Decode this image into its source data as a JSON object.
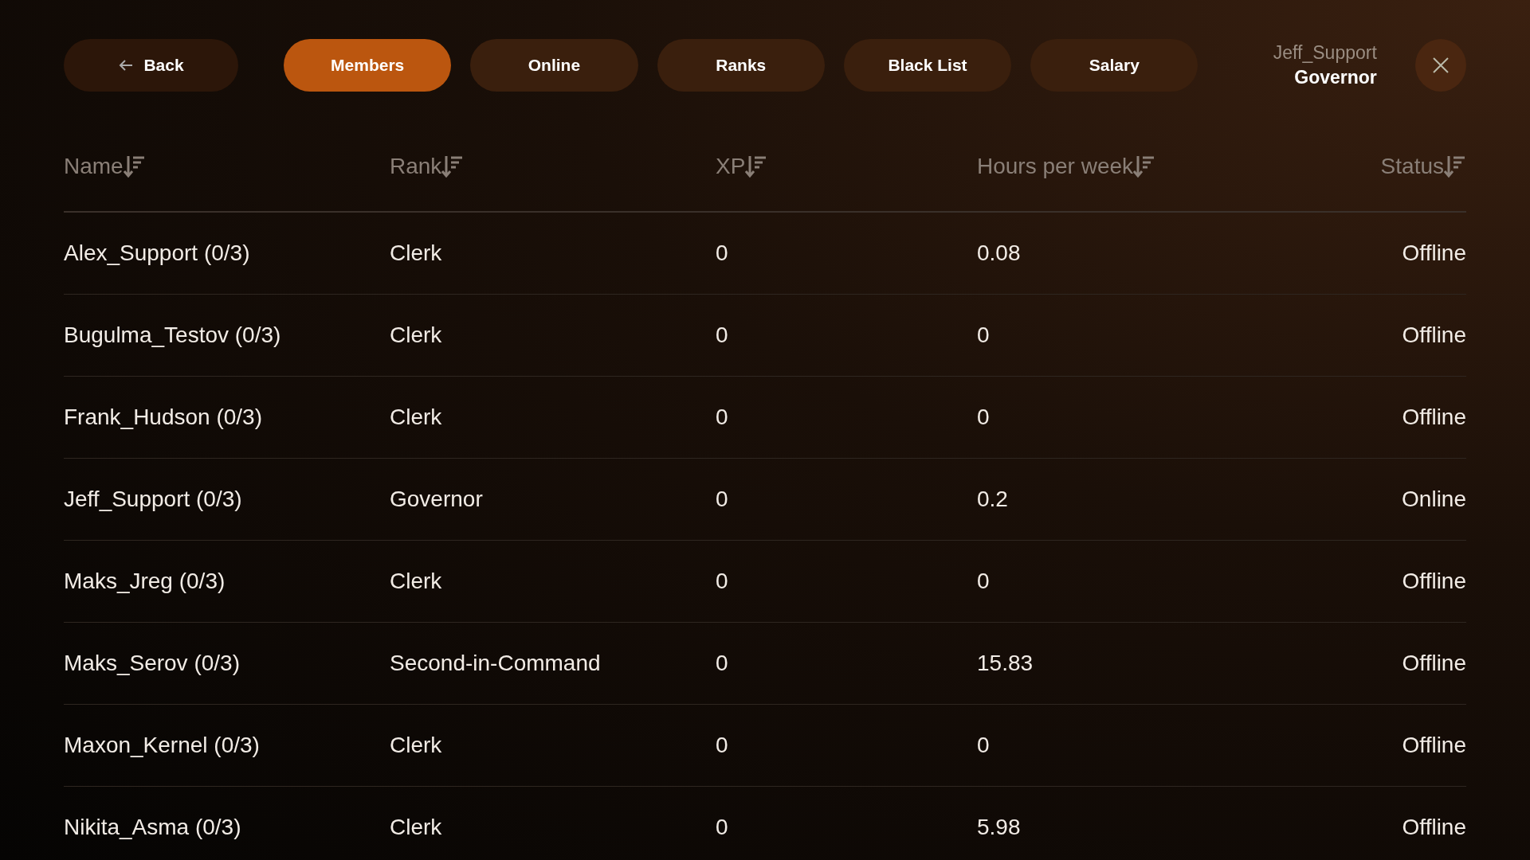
{
  "back_button": {
    "label": "Back"
  },
  "tabs": [
    {
      "label": "Members",
      "selected": true
    },
    {
      "label": "Online",
      "selected": false
    },
    {
      "label": "Ranks",
      "selected": false
    },
    {
      "label": "Black List",
      "selected": false
    },
    {
      "label": "Salary",
      "selected": false
    }
  ],
  "user": {
    "name": "Jeff_Support",
    "rank": "Governor"
  },
  "table": {
    "columns": [
      "Name",
      "Rank",
      "XP",
      "Hours per week",
      "Status"
    ],
    "rows": [
      [
        "Alex_Support (0/3)",
        "Clerk",
        "0",
        "0.08",
        "Offline"
      ],
      [
        "Bugulma_Testov (0/3)",
        "Clerk",
        "0",
        "0",
        "Offline"
      ],
      [
        "Frank_Hudson (0/3)",
        "Clerk",
        "0",
        "0",
        "Offline"
      ],
      [
        "Jeff_Support (0/3)",
        "Governor",
        "0",
        "0.2",
        "Online"
      ],
      [
        "Maks_Jreg (0/3)",
        "Clerk",
        "0",
        "0",
        "Offline"
      ],
      [
        "Maks_Serov (0/3)",
        "Second-in-Command",
        "0",
        "15.83",
        "Offline"
      ],
      [
        "Maxon_Kernel (0/3)",
        "Clerk",
        "0",
        "0",
        "Offline"
      ],
      [
        "Nikita_Asma (0/3)",
        "Clerk",
        "0",
        "5.98",
        "Offline"
      ]
    ]
  }
}
